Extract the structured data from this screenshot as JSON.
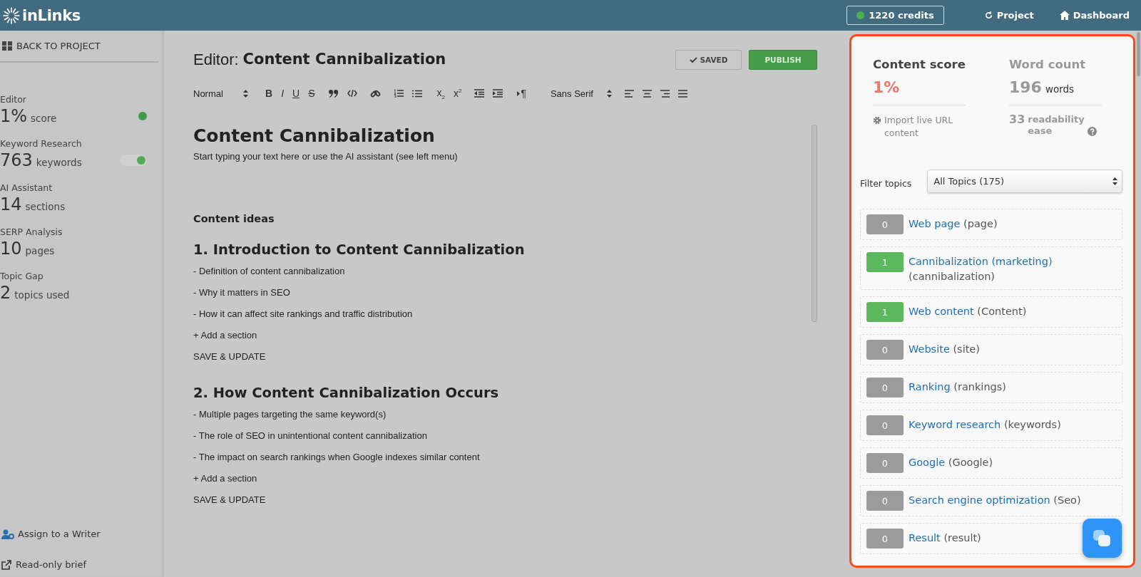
{
  "topbar": {
    "logo": "inLinks",
    "credits": "1220 credits",
    "links": [
      {
        "kind": "refresh",
        "label": "Project"
      },
      {
        "kind": "home",
        "label": "Dashboard"
      }
    ]
  },
  "sidebar": {
    "back": "BACK TO PROJECT",
    "stats": [
      {
        "kind": "dot",
        "label": "Editor",
        "value": "1%",
        "unit": "score"
      },
      {
        "kind": "toggle",
        "on": true,
        "label": "Keyword Research",
        "value": "763",
        "unit": "keywords"
      },
      {
        "kind": "plain",
        "label": "AI Assistant",
        "value": "14",
        "unit": "sections"
      },
      {
        "kind": "plain",
        "label": "SERP Analysis",
        "value": "10",
        "unit": "pages"
      },
      {
        "kind": "plain",
        "label": "Topic Gap",
        "value": "2",
        "unit": "topics used"
      }
    ],
    "footer": [
      {
        "kind": "user-gear",
        "label": "Assign to a Writer"
      },
      {
        "kind": "external",
        "label": "Read-only brief"
      }
    ]
  },
  "editor": {
    "title_prefix": "Editor:",
    "title": "Content Cannibalization",
    "saved": "SAVED",
    "publish": "PUBLISH",
    "toolbar": [
      {
        "kind": "select",
        "label": "Normal"
      },
      {
        "kind": "bold",
        "label": "B"
      },
      {
        "kind": "italic",
        "label": "I"
      },
      {
        "kind": "underline",
        "label": "U"
      },
      {
        "kind": "strike",
        "label": "S"
      },
      {
        "kind": "quote"
      },
      {
        "kind": "code"
      },
      {
        "kind": "link"
      },
      {
        "kind": "ordered-list"
      },
      {
        "kind": "bullet-list"
      },
      {
        "kind": "sub",
        "label": "x$_{2}$"
      },
      {
        "kind": "sup",
        "label": "x$^{2}$"
      },
      {
        "kind": "outdent"
      },
      {
        "kind": "indent"
      },
      {
        "kind": "direction",
        "label": "¶"
      },
      {
        "kind": "select",
        "label": "Sans Serif"
      },
      {
        "kind": "align-left"
      },
      {
        "kind": "align-center"
      },
      {
        "kind": "align-right"
      },
      {
        "kind": "justify"
      }
    ],
    "document": {
      "heading": "Content Cannibalization",
      "intro": "Start typing your text here or use the AI assistant (see left menu)",
      "ideas_title": "Content ideas",
      "sections": [
        {
          "heading": "1. Introduction to Content Cannibalization",
          "points": [
            "- Definition of content cannibalization",
            "- Why it matters in SEO",
            "- How it can affect site rankings and traffic distribution"
          ],
          "add": "+ Add a section",
          "save": "SAVE & UPDATE"
        },
        {
          "heading": "2. How Content Cannibalization Occurs",
          "points": [
            "- Multiple pages targeting the same keyword(s)",
            "- The role of SEO in unintentional content cannibalization",
            "- The impact on search rankings when Google indexes similar content"
          ],
          "add": "+ Add a section",
          "save": "SAVE & UPDATE"
        }
      ]
    }
  },
  "panel": {
    "score_title": "Content score",
    "score": "1%",
    "words_title": "Word count",
    "words": "196",
    "words_unit": "words",
    "import": "Import live URL content",
    "readability": "33",
    "readability_unit": "readability ease",
    "filter_label": "Filter topics",
    "filter_value": "All Topics (175)",
    "topics": [
      {
        "count": "0",
        "used": false,
        "name": "Web page",
        "term": "(page)"
      },
      {
        "count": "1",
        "used": true,
        "name": "Cannibalization (marketing)",
        "term": "(cannibalization)"
      },
      {
        "count": "1",
        "used": true,
        "name": "Web content",
        "term": "(Content)"
      },
      {
        "count": "0",
        "used": false,
        "name": "Website",
        "term": "(site)"
      },
      {
        "count": "0",
        "used": false,
        "name": "Ranking",
        "term": "(rankings)"
      },
      {
        "count": "0",
        "used": false,
        "name": "Keyword research",
        "term": "(keywords)"
      },
      {
        "count": "0",
        "used": false,
        "name": "Google",
        "term": "(Google)"
      },
      {
        "count": "0",
        "used": false,
        "name": "Search engine optimization",
        "term": "(Seo)"
      },
      {
        "count": "0",
        "used": false,
        "name": "Result",
        "term": "(result)"
      }
    ]
  }
}
